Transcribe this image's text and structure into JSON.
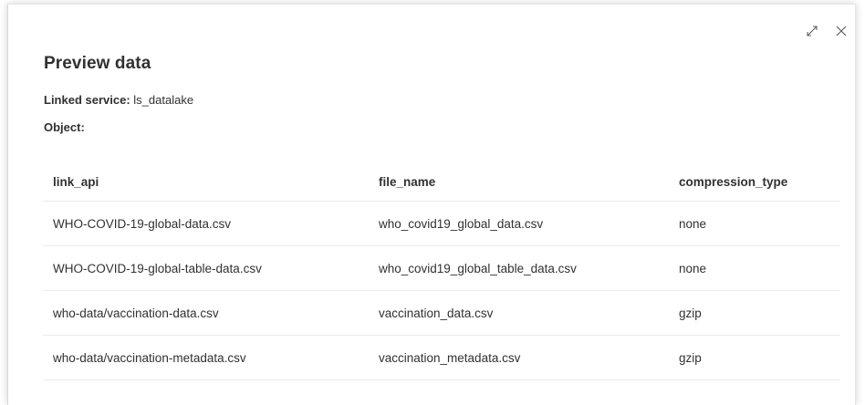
{
  "dialog": {
    "title": "Preview data",
    "linked_service_label": "Linked service:",
    "linked_service_value": "ls_datalake",
    "object_label": "Object:",
    "object_value": ""
  },
  "icons": {
    "expand": "expand-icon",
    "close": "close-icon"
  },
  "table": {
    "columns": [
      "link_api",
      "file_name",
      "compression_type"
    ],
    "rows": [
      [
        "WHO-COVID-19-global-data.csv",
        "who_covid19_global_data.csv",
        "none"
      ],
      [
        "WHO-COVID-19-global-table-data.csv",
        "who_covid19_global_table_data.csv",
        "none"
      ],
      [
        "who-data/vaccination-data.csv",
        "vaccination_data.csv",
        "gzip"
      ],
      [
        "who-data/vaccination-metadata.csv",
        "vaccination_metadata.csv",
        "gzip"
      ]
    ]
  }
}
